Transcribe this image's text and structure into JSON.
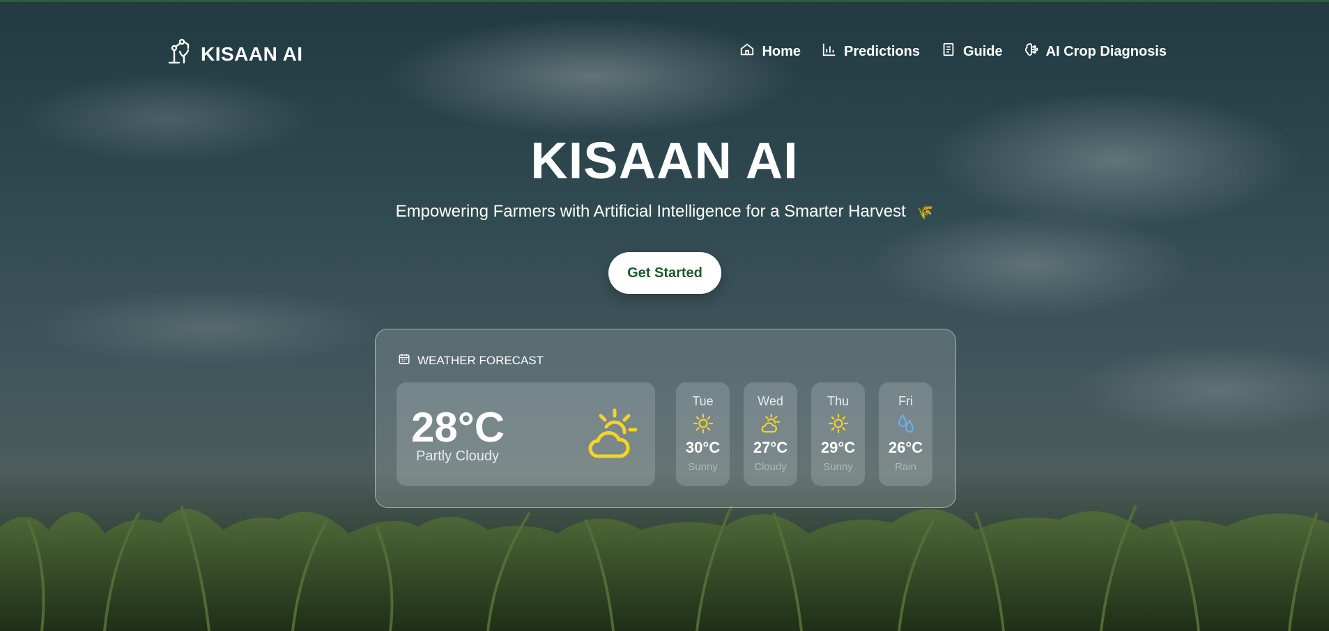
{
  "brand": {
    "name": "KISAAN AI"
  },
  "nav": {
    "items": [
      {
        "label": "Home",
        "icon": "home-icon"
      },
      {
        "label": "Predictions",
        "icon": "bar-chart-icon"
      },
      {
        "label": "Guide",
        "icon": "document-icon"
      },
      {
        "label": "AI Crop Diagnosis",
        "icon": "brain-icon"
      }
    ]
  },
  "hero": {
    "title": "KISAAN AI",
    "subtitle": "Empowering Farmers with Artificial Intelligence for a Smarter Harvest",
    "subtitle_emoji": "🌾",
    "cta_label": "Get Started"
  },
  "weather": {
    "heading": "WEATHER FORECAST",
    "current": {
      "temp": "28°C",
      "condition": "Partly Cloudy",
      "icon": "partly-cloudy-icon"
    },
    "forecast": [
      {
        "day": "Tue",
        "temp": "30°C",
        "condition": "Sunny",
        "icon": "sun-icon"
      },
      {
        "day": "Wed",
        "temp": "27°C",
        "condition": "Cloudy",
        "icon": "partly-cloudy-icon"
      },
      {
        "day": "Thu",
        "temp": "29°C",
        "condition": "Sunny",
        "icon": "sun-icon"
      },
      {
        "day": "Fri",
        "temp": "26°C",
        "condition": "Rain",
        "icon": "rain-drops-icon"
      }
    ]
  },
  "colors": {
    "accent_green": "#1e5a2c",
    "sun_yellow": "#f5d327",
    "rain_blue": "#6aaee8"
  }
}
